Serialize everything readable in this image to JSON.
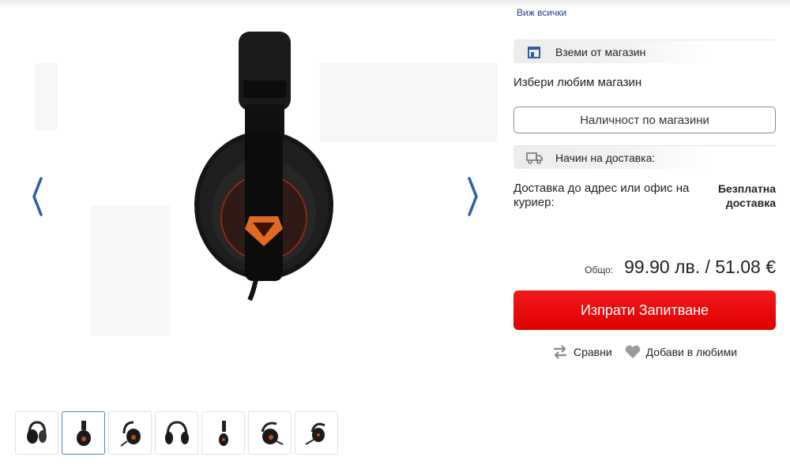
{
  "gallery": {
    "prev_icon": "chevron-left-icon",
    "next_icon": "chevron-right-icon",
    "thumbnail_count": 7,
    "active_thumbnail": 2
  },
  "panel": {
    "view_all": "Виж всички",
    "pickup": {
      "icon": "store-icon",
      "label": "Вземи от магазин"
    },
    "choose_store": "Избери любим магазин",
    "availability_button": "Наличност по магазини",
    "delivery": {
      "icon": "truck-icon",
      "label": "Начин на доставка:"
    },
    "delivery_option": "Доставка до адрес или офис на куриер:",
    "delivery_price_line1": "Безплатна",
    "delivery_price_line2": "доставка",
    "total_label": "Общо:",
    "total_value": "99.90 лв. / 51.08 €",
    "inquiry_button": "Изпрати Запитване",
    "compare": {
      "icon": "compare-icon",
      "label": "Сравни"
    },
    "favorites": {
      "icon": "heart-icon",
      "label": "Добави в любими"
    }
  },
  "colors": {
    "accent_red": "#e60a0a",
    "link_blue": "#1e3f8f",
    "arrow_blue": "#2c5fa8",
    "thumb_active_border": "#4a86c8"
  }
}
